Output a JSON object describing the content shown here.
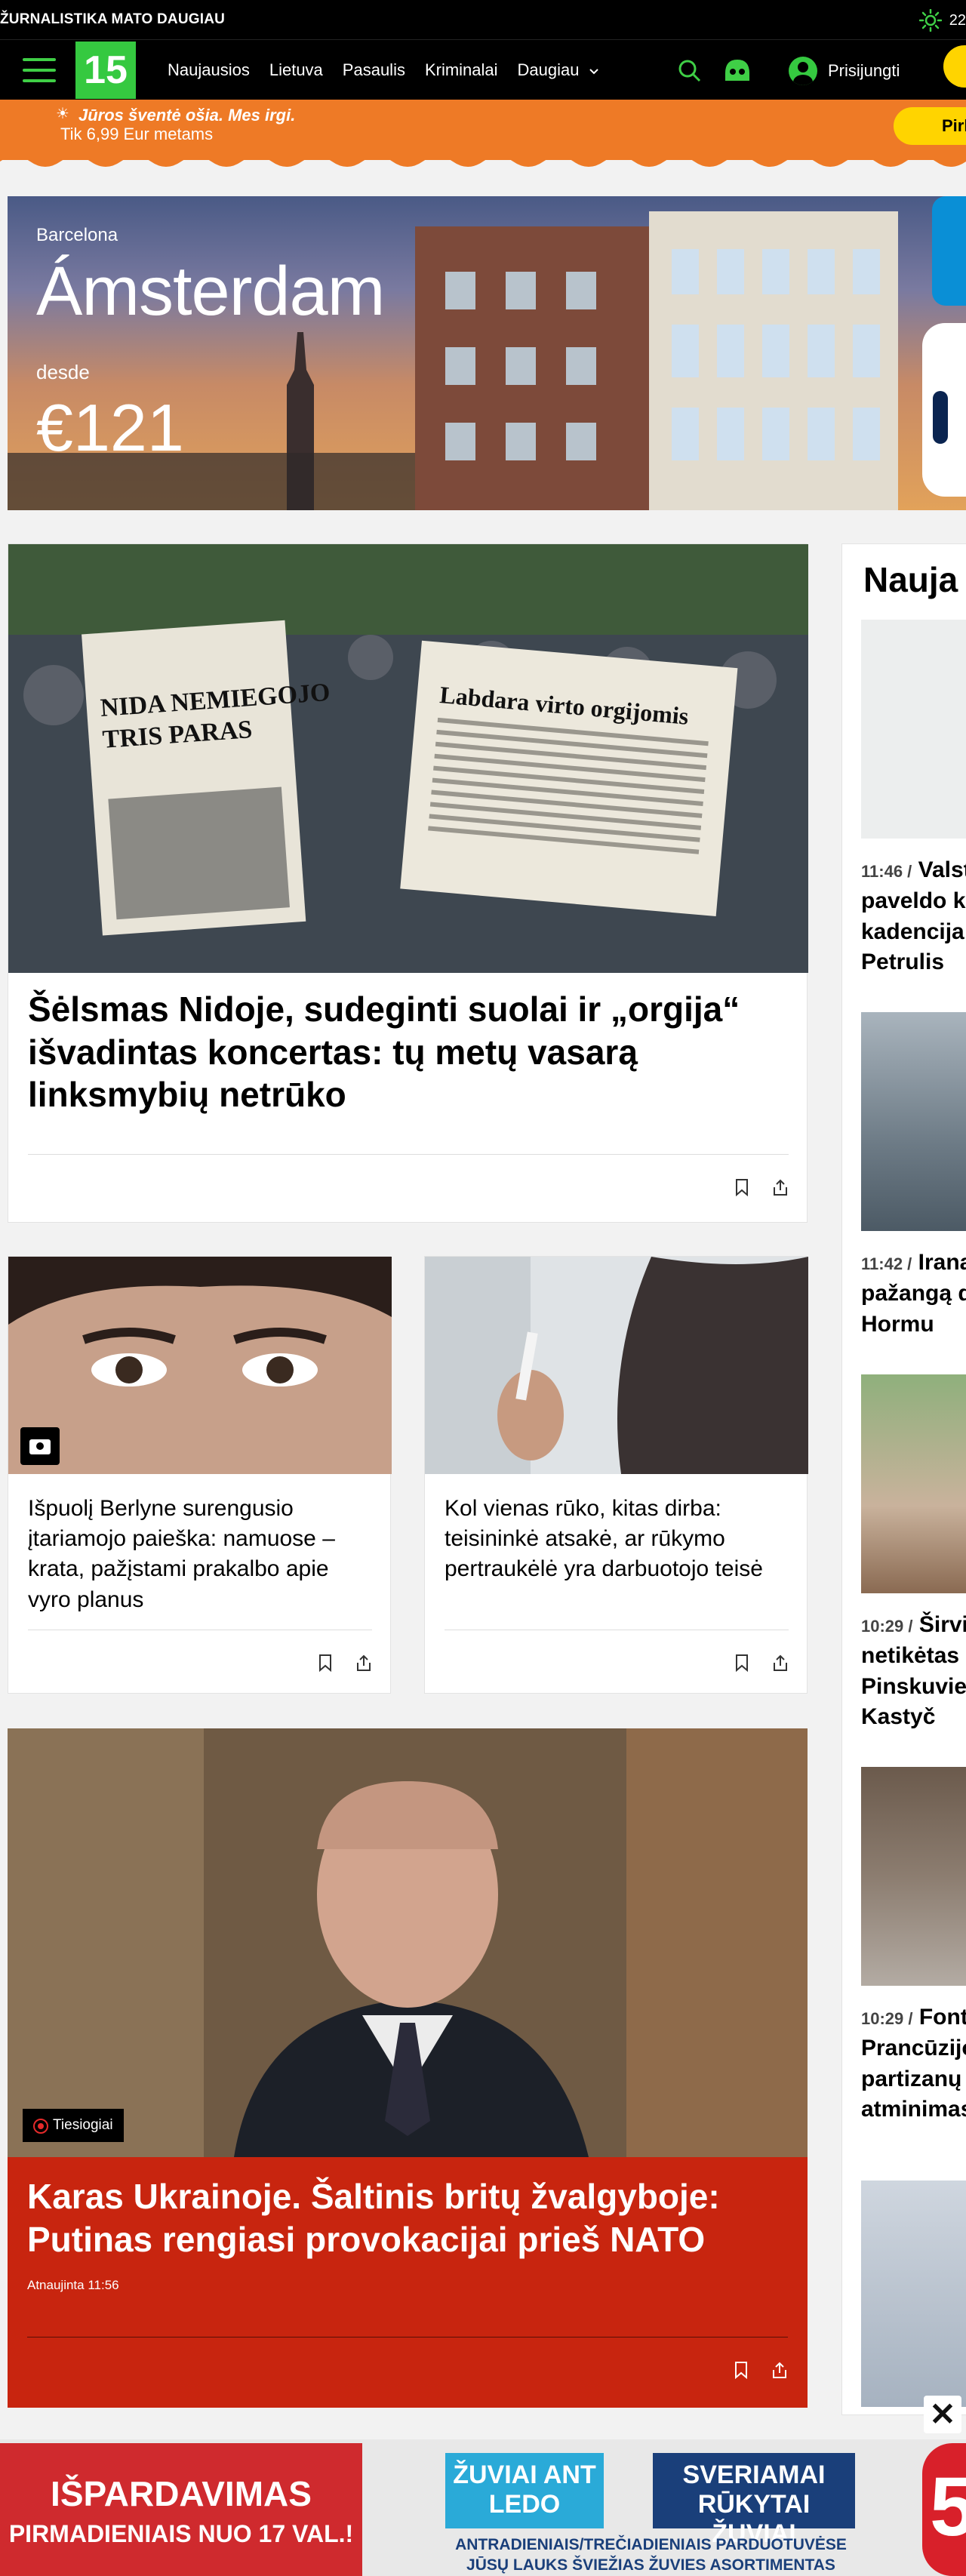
{
  "topbar": {
    "tagline": "ŽURNALISTIKA MATO DAUGIAU",
    "temperature": "22"
  },
  "nav": {
    "logo": "15",
    "links": [
      "Naujausios",
      "Lietuva",
      "Pasaulis",
      "Kriminalai",
      "Daugiau"
    ],
    "login_label": "Prisijungti"
  },
  "promo": {
    "line1": "Jūros šventė ošia. Mes irgi.",
    "line2": "Tik 6,99 Eur metams",
    "button": "Pirk"
  },
  "banner": {
    "eyebrow": "Barcelona",
    "city": "Ámsterdam",
    "from_label": "desde",
    "price": "€121"
  },
  "articles": {
    "main": {
      "title": "Šėlsmas Nidoje, sudeginti suolai ir „orgija“ išvadintas koncertas: tų metų vasarą linksmybių netrūko"
    },
    "small1": {
      "title": "Išpuolį Berlyne surengusio įtariamojo paieška: namuose – krata, pažįstami prakalbo apie vyro planus"
    },
    "small2": {
      "title": "Kol vienas rūko, kitas dirba: teisininkė atsakė, ar rūkymo pertraukėlė yra darbuotojo teisė"
    },
    "live": {
      "badge": "Tiesiogiai",
      "title": "Karas Ukrainoje. Šaltinis britų žvalgyboje: Putinas rengiasi provokacijai prieš NATO",
      "updated": "Atnaujinta 11:56"
    }
  },
  "sidebar": {
    "heading": "Nauja",
    "items": [
      {
        "time": "11:46 /",
        "text": "Valst paveldo k kadencija Petrulis"
      },
      {
        "time": "11:42 /",
        "text": "Irana pažangą d dėl Hormu"
      },
      {
        "time": "10:29 /",
        "text": "Širvi netikėtas Pinskuvie su Kastyč"
      },
      {
        "time": "10:29 /",
        "text": "Font Prancūzijo partizanų atminimas"
      }
    ]
  },
  "ads": {
    "a1_line1": "IŠPARDAVIMAS",
    "a1_line2": "PIRMADIENIAIS NUO 17 VAL.!",
    "a2": "ŽUVIAI ANT LEDO",
    "a3": "SVERIAMAI RŪKYTAI ŽUVIAI",
    "a4_line1": "ANTRADIENIAIS/TREČIADIENIAIS PARDUOTUVĖSE",
    "a4_line2": "JŪSŲ LAUKS ŠVIEŽIAS ŽUVIES ASORTIMENTAS",
    "a5": "5",
    "close": "✕"
  }
}
